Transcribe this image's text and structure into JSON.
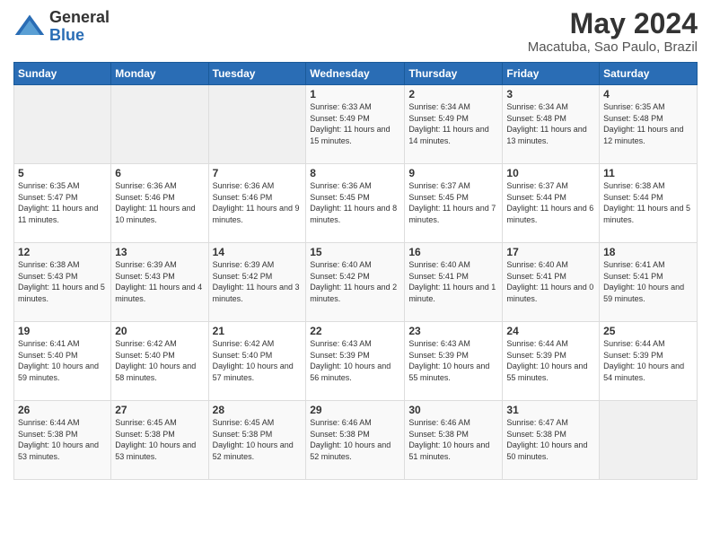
{
  "logo": {
    "general": "General",
    "blue": "Blue"
  },
  "header": {
    "month_year": "May 2024",
    "location": "Macatuba, Sao Paulo, Brazil"
  },
  "days_of_week": [
    "Sunday",
    "Monday",
    "Tuesday",
    "Wednesday",
    "Thursday",
    "Friday",
    "Saturday"
  ],
  "weeks": [
    [
      {
        "day": "",
        "sunrise": "",
        "sunset": "",
        "daylight": ""
      },
      {
        "day": "",
        "sunrise": "",
        "sunset": "",
        "daylight": ""
      },
      {
        "day": "",
        "sunrise": "",
        "sunset": "",
        "daylight": ""
      },
      {
        "day": "1",
        "sunrise": "Sunrise: 6:33 AM",
        "sunset": "Sunset: 5:49 PM",
        "daylight": "Daylight: 11 hours and 15 minutes."
      },
      {
        "day": "2",
        "sunrise": "Sunrise: 6:34 AM",
        "sunset": "Sunset: 5:49 PM",
        "daylight": "Daylight: 11 hours and 14 minutes."
      },
      {
        "day": "3",
        "sunrise": "Sunrise: 6:34 AM",
        "sunset": "Sunset: 5:48 PM",
        "daylight": "Daylight: 11 hours and 13 minutes."
      },
      {
        "day": "4",
        "sunrise": "Sunrise: 6:35 AM",
        "sunset": "Sunset: 5:48 PM",
        "daylight": "Daylight: 11 hours and 12 minutes."
      }
    ],
    [
      {
        "day": "5",
        "sunrise": "Sunrise: 6:35 AM",
        "sunset": "Sunset: 5:47 PM",
        "daylight": "Daylight: 11 hours and 11 minutes."
      },
      {
        "day": "6",
        "sunrise": "Sunrise: 6:36 AM",
        "sunset": "Sunset: 5:46 PM",
        "daylight": "Daylight: 11 hours and 10 minutes."
      },
      {
        "day": "7",
        "sunrise": "Sunrise: 6:36 AM",
        "sunset": "Sunset: 5:46 PM",
        "daylight": "Daylight: 11 hours and 9 minutes."
      },
      {
        "day": "8",
        "sunrise": "Sunrise: 6:36 AM",
        "sunset": "Sunset: 5:45 PM",
        "daylight": "Daylight: 11 hours and 8 minutes."
      },
      {
        "day": "9",
        "sunrise": "Sunrise: 6:37 AM",
        "sunset": "Sunset: 5:45 PM",
        "daylight": "Daylight: 11 hours and 7 minutes."
      },
      {
        "day": "10",
        "sunrise": "Sunrise: 6:37 AM",
        "sunset": "Sunset: 5:44 PM",
        "daylight": "Daylight: 11 hours and 6 minutes."
      },
      {
        "day": "11",
        "sunrise": "Sunrise: 6:38 AM",
        "sunset": "Sunset: 5:44 PM",
        "daylight": "Daylight: 11 hours and 5 minutes."
      }
    ],
    [
      {
        "day": "12",
        "sunrise": "Sunrise: 6:38 AM",
        "sunset": "Sunset: 5:43 PM",
        "daylight": "Daylight: 11 hours and 5 minutes."
      },
      {
        "day": "13",
        "sunrise": "Sunrise: 6:39 AM",
        "sunset": "Sunset: 5:43 PM",
        "daylight": "Daylight: 11 hours and 4 minutes."
      },
      {
        "day": "14",
        "sunrise": "Sunrise: 6:39 AM",
        "sunset": "Sunset: 5:42 PM",
        "daylight": "Daylight: 11 hours and 3 minutes."
      },
      {
        "day": "15",
        "sunrise": "Sunrise: 6:40 AM",
        "sunset": "Sunset: 5:42 PM",
        "daylight": "Daylight: 11 hours and 2 minutes."
      },
      {
        "day": "16",
        "sunrise": "Sunrise: 6:40 AM",
        "sunset": "Sunset: 5:41 PM",
        "daylight": "Daylight: 11 hours and 1 minute."
      },
      {
        "day": "17",
        "sunrise": "Sunrise: 6:40 AM",
        "sunset": "Sunset: 5:41 PM",
        "daylight": "Daylight: 11 hours and 0 minutes."
      },
      {
        "day": "18",
        "sunrise": "Sunrise: 6:41 AM",
        "sunset": "Sunset: 5:41 PM",
        "daylight": "Daylight: 10 hours and 59 minutes."
      }
    ],
    [
      {
        "day": "19",
        "sunrise": "Sunrise: 6:41 AM",
        "sunset": "Sunset: 5:40 PM",
        "daylight": "Daylight: 10 hours and 59 minutes."
      },
      {
        "day": "20",
        "sunrise": "Sunrise: 6:42 AM",
        "sunset": "Sunset: 5:40 PM",
        "daylight": "Daylight: 10 hours and 58 minutes."
      },
      {
        "day": "21",
        "sunrise": "Sunrise: 6:42 AM",
        "sunset": "Sunset: 5:40 PM",
        "daylight": "Daylight: 10 hours and 57 minutes."
      },
      {
        "day": "22",
        "sunrise": "Sunrise: 6:43 AM",
        "sunset": "Sunset: 5:39 PM",
        "daylight": "Daylight: 10 hours and 56 minutes."
      },
      {
        "day": "23",
        "sunrise": "Sunrise: 6:43 AM",
        "sunset": "Sunset: 5:39 PM",
        "daylight": "Daylight: 10 hours and 55 minutes."
      },
      {
        "day": "24",
        "sunrise": "Sunrise: 6:44 AM",
        "sunset": "Sunset: 5:39 PM",
        "daylight": "Daylight: 10 hours and 55 minutes."
      },
      {
        "day": "25",
        "sunrise": "Sunrise: 6:44 AM",
        "sunset": "Sunset: 5:39 PM",
        "daylight": "Daylight: 10 hours and 54 minutes."
      }
    ],
    [
      {
        "day": "26",
        "sunrise": "Sunrise: 6:44 AM",
        "sunset": "Sunset: 5:38 PM",
        "daylight": "Daylight: 10 hours and 53 minutes."
      },
      {
        "day": "27",
        "sunrise": "Sunrise: 6:45 AM",
        "sunset": "Sunset: 5:38 PM",
        "daylight": "Daylight: 10 hours and 53 minutes."
      },
      {
        "day": "28",
        "sunrise": "Sunrise: 6:45 AM",
        "sunset": "Sunset: 5:38 PM",
        "daylight": "Daylight: 10 hours and 52 minutes."
      },
      {
        "day": "29",
        "sunrise": "Sunrise: 6:46 AM",
        "sunset": "Sunset: 5:38 PM",
        "daylight": "Daylight: 10 hours and 52 minutes."
      },
      {
        "day": "30",
        "sunrise": "Sunrise: 6:46 AM",
        "sunset": "Sunset: 5:38 PM",
        "daylight": "Daylight: 10 hours and 51 minutes."
      },
      {
        "day": "31",
        "sunrise": "Sunrise: 6:47 AM",
        "sunset": "Sunset: 5:38 PM",
        "daylight": "Daylight: 10 hours and 50 minutes."
      },
      {
        "day": "",
        "sunrise": "",
        "sunset": "",
        "daylight": ""
      }
    ]
  ]
}
